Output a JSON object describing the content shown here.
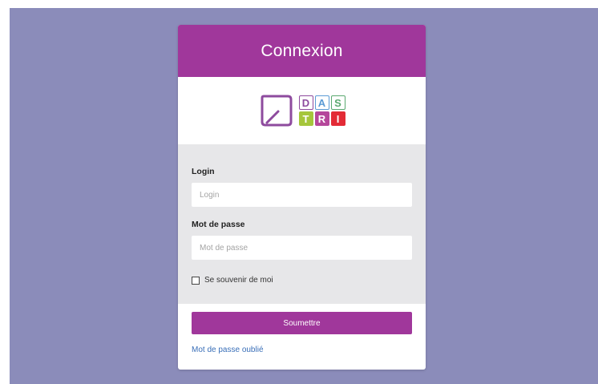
{
  "colors": {
    "accent": "#a0379b",
    "backdrop": "#8b8cba",
    "form_background": "#e7e7e9",
    "link": "#3a6fb8"
  },
  "header": {
    "title": "Connexion"
  },
  "logo": {
    "icon": "dastri-logo",
    "tiles": [
      {
        "letter": "D",
        "style": "outline",
        "color": "#8e4b9e"
      },
      {
        "letter": "A",
        "style": "outline",
        "color": "#5b9bd5"
      },
      {
        "letter": "S",
        "style": "outline",
        "color": "#5aa86f"
      },
      {
        "letter": "T",
        "style": "filled",
        "color": "#a5c63b"
      },
      {
        "letter": "R",
        "style": "filled",
        "color": "#b5479b"
      },
      {
        "letter": "I",
        "style": "filled",
        "color": "#e32b36"
      }
    ]
  },
  "form": {
    "login": {
      "label": "Login",
      "placeholder": "Login",
      "value": ""
    },
    "password": {
      "label": "Mot de passe",
      "placeholder": "Mot de passe",
      "value": ""
    },
    "remember": {
      "label": "Se souvenir de moi",
      "checked": false
    }
  },
  "actions": {
    "submit_label": "Soumettre",
    "forgot_label": "Mot de passe oublié"
  }
}
